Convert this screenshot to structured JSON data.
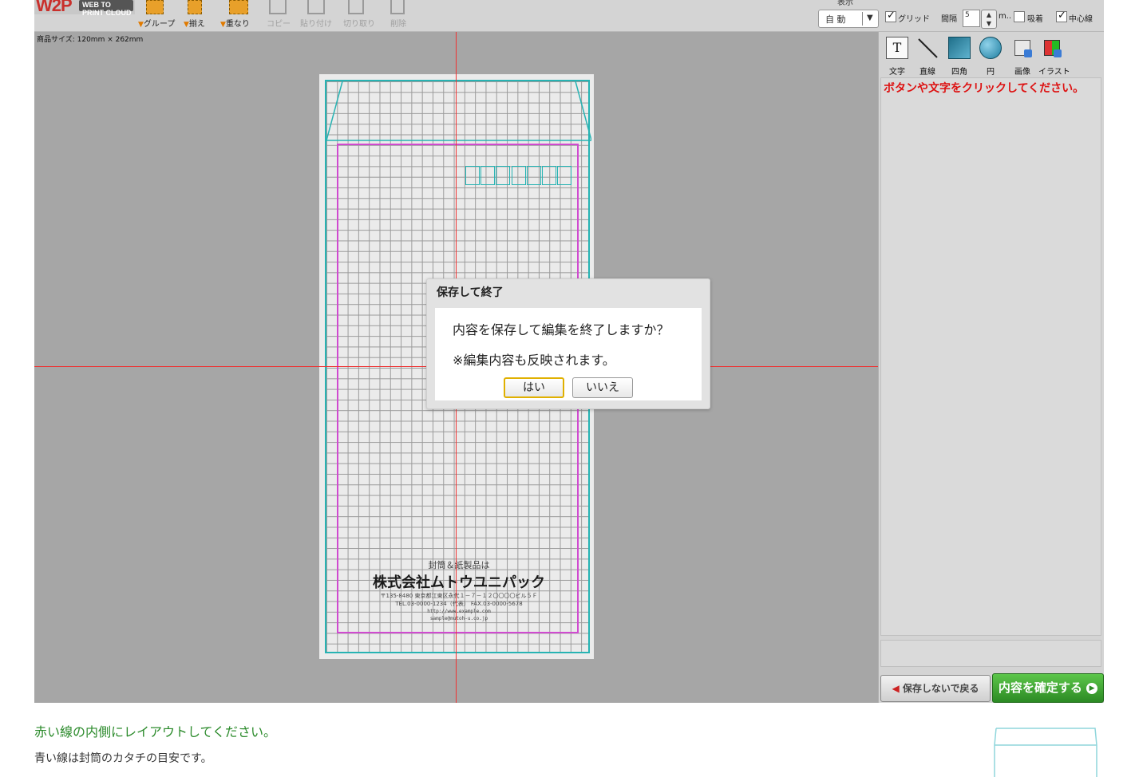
{
  "toolbar": {
    "logo_text": "W2P",
    "logo_sub": "WEB TO PRINT CLOUD",
    "group_label": "グループ",
    "align_label": "揃え",
    "stack_label": "重なり",
    "copy_label": "コピー",
    "paste_label": "貼り付け",
    "cut_label": "切り取り",
    "delete_label": "削除",
    "view_label": "表示",
    "zoom_value": "自 動",
    "grid_label": "グリッド",
    "interval_label": "間隔",
    "interval_value": "5",
    "unit_label": "m..",
    "snap_label": "吸着",
    "center_line_label": "中心線",
    "grid_checked": true,
    "snap_checked": false,
    "center_line_checked": true
  },
  "canvas": {
    "size_label": "商品サイズ: 120mm × 262mm",
    "address": {
      "line1": "封筒＆紙製品は",
      "line2": "株式会社ムトウユニパック",
      "line3": "〒135-8480 東京都江東区永代１－７－１２〇〇〇〇ビル５Ｆ",
      "line4": "TEL.03-0000-1234（代表） FAX.03-0000-5678",
      "line5": "http://www.example.com",
      "line6": "sample@mutoh-u.co.jp"
    }
  },
  "dialog": {
    "title": "保存して終了",
    "message1": "内容を保存して編集を終了しますか？",
    "message2": "※編集内容も反映されます。",
    "yes_label": "はい",
    "no_label": "いいえ"
  },
  "tools": {
    "text_label": "文字",
    "line_label": "直線",
    "rect_label": "四角",
    "circle_label": "円",
    "image_label": "画像",
    "illust_label": "イラスト",
    "text_glyph": "T"
  },
  "panel": {
    "hint": "ボタンや文字をクリックしてください。",
    "back_label": "保存しないで戻る",
    "confirm_label": "内容を確定する"
  },
  "notes": {
    "red_line": "赤い線の内側にレイアウトしてください。",
    "blue_line": "青い線は封筒のカタチの目安です。"
  },
  "colors": {
    "canvas_bg": "#a6a6a6",
    "center_line": "#ee3333",
    "envelope_outline": "#27b3b3",
    "safe_area": "#d04ad0",
    "confirm_button": "#2c8a24",
    "hint_text": "#dd1111"
  }
}
